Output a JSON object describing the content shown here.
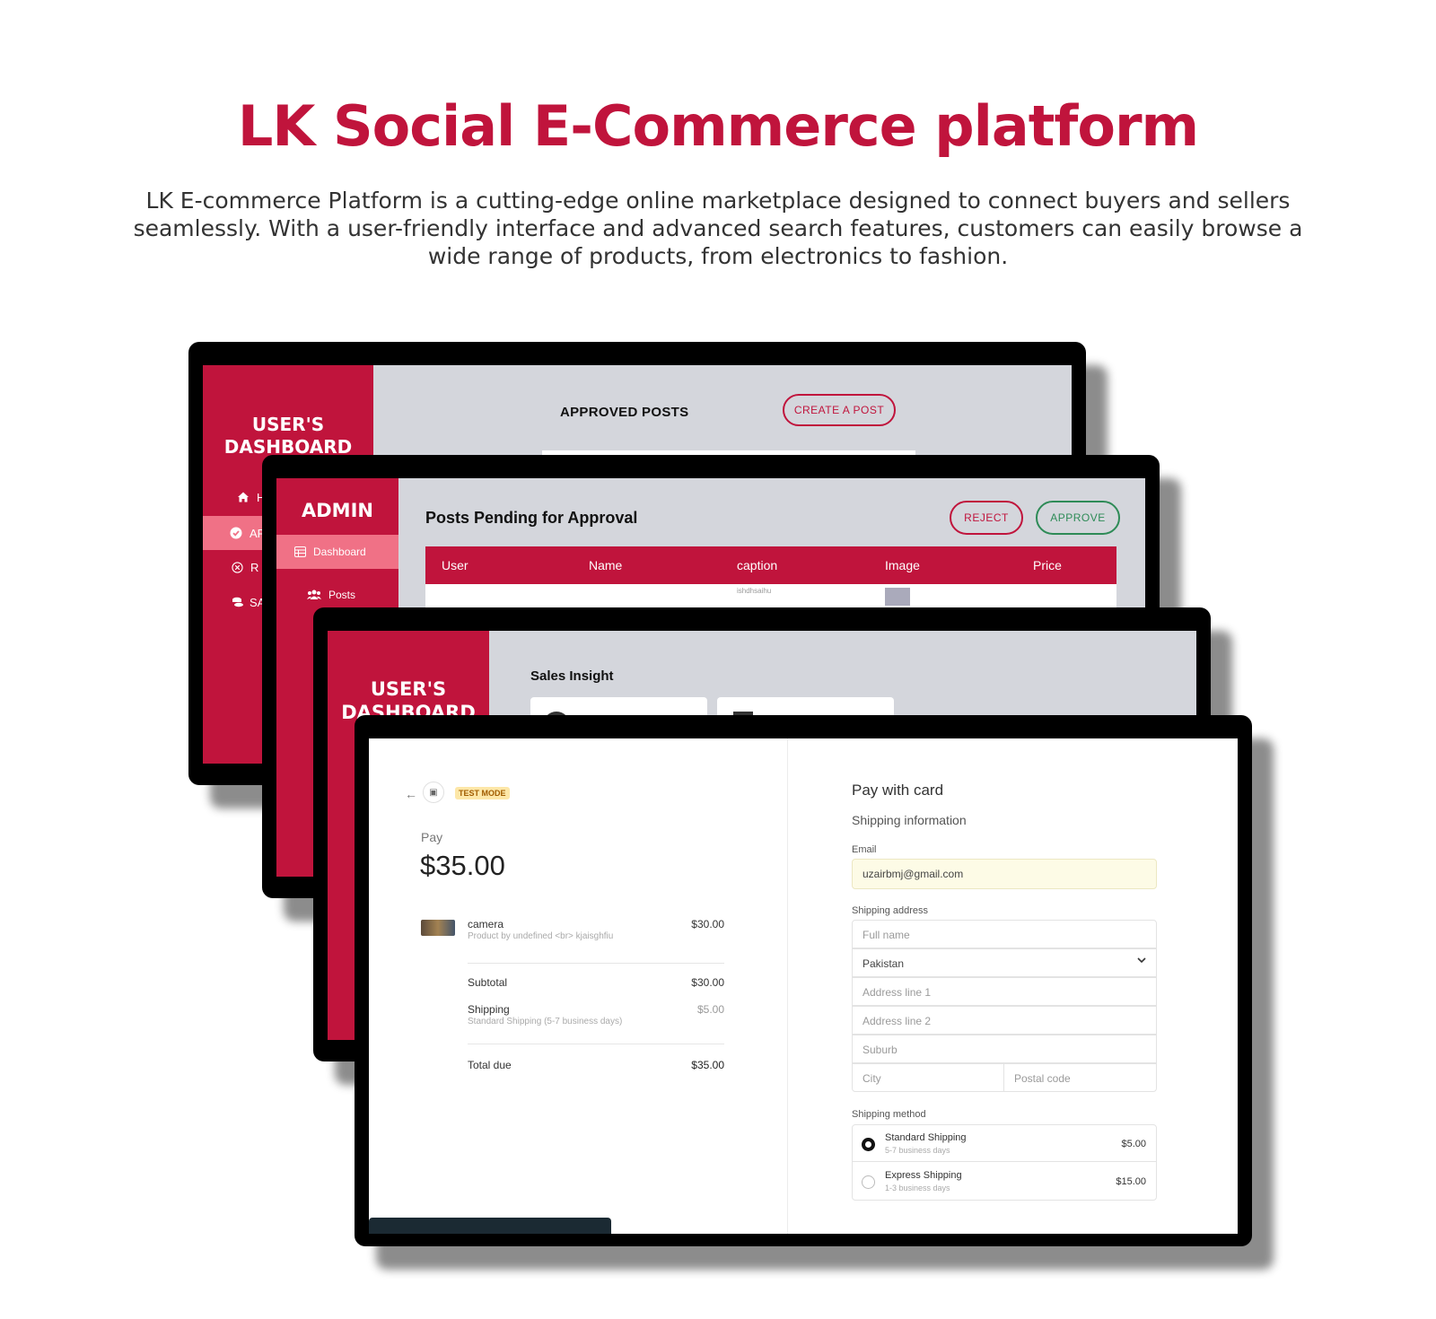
{
  "hero": {
    "title": "LK Social E-Commerce platform",
    "description": "LK E-commerce Platform is a cutting-edge online marketplace designed to connect buyers and sellers seamlessly. With a user-friendly interface and advanced search features, customers can easily browse a wide range of products, from electronics to fashion."
  },
  "colors": {
    "brand": "#c0143c",
    "active_item": "#f07186",
    "approve": "#2e8b57",
    "test_mode": "#fde7a8"
  },
  "screen_user_posts": {
    "sidebar_title_line1": "USER'S",
    "sidebar_title_line2": "DASHBOARD",
    "items": [
      {
        "icon": "home-icon",
        "label": "H"
      },
      {
        "icon": "check-circle-icon",
        "label": "AP"
      },
      {
        "icon": "x-circle-icon",
        "label": "R"
      },
      {
        "icon": "coins-icon",
        "label": "SA"
      }
    ],
    "heading": "APPROVED POSTS",
    "create_button": "CREATE A POST"
  },
  "screen_admin": {
    "sidebar_title": "ADMIN",
    "items": [
      {
        "icon": "table-icon",
        "label": "Dashboard"
      },
      {
        "icon": "users-icon",
        "label": "Posts"
      }
    ],
    "heading": "Posts Pending for Approval",
    "reject_button": "REJECT",
    "approve_button": "APPROVE",
    "columns": [
      "User",
      "Name",
      "caption",
      "Image",
      "Price"
    ],
    "row_preview": "ishdhsaihu"
  },
  "screen_sales": {
    "sidebar_title_line1": "USER'S",
    "sidebar_title_line2": "DASHBOARD",
    "heading": "Sales Insight"
  },
  "checkout": {
    "test_mode": "TEST MODE",
    "pay_label": "Pay",
    "amount": "$35.00",
    "item_name": "camera",
    "item_desc": "Product by undefined <br> kjaisghfiu",
    "item_price": "$30.00",
    "subtotal_label": "Subtotal",
    "subtotal": "$30.00",
    "shipping_label": "Shipping",
    "shipping_desc": "Standard Shipping (5-7 business days)",
    "shipping": "$5.00",
    "total_label": "Total due",
    "total": "$35.00",
    "pay_title": "Pay with card",
    "shipping_info": "Shipping information",
    "email_label": "Email",
    "email": "uzairbmj@gmail.com",
    "address_label": "Shipping address",
    "full_name_ph": "Full name",
    "country": "Pakistan",
    "addr1_ph": "Address line 1",
    "addr2_ph": "Address line 2",
    "suburb_ph": "Suburb",
    "city_ph": "City",
    "postal_ph": "Postal code",
    "method_label": "Shipping method",
    "methods": [
      {
        "name": "Standard Shipping",
        "days": "5-7 business days",
        "price": "$5.00",
        "selected": true
      },
      {
        "name": "Express Shipping",
        "days": "1-3 business days",
        "price": "$15.00",
        "selected": false
      }
    ]
  }
}
